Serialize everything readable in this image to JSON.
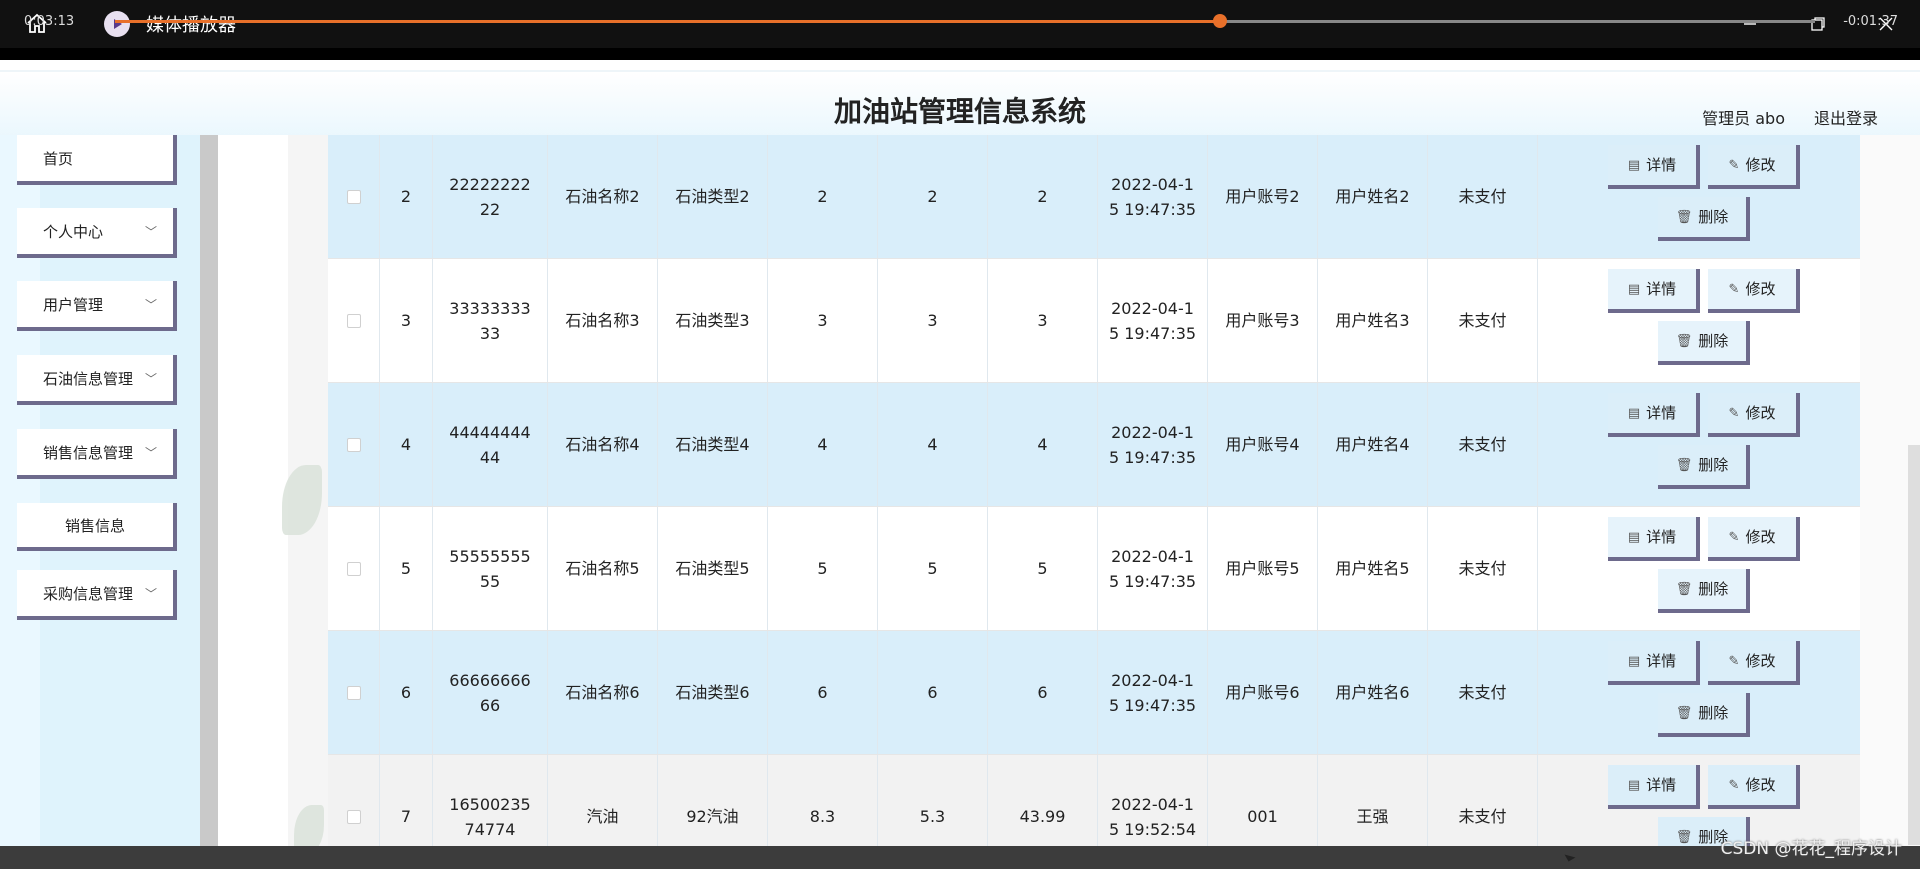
{
  "player": {
    "title": "媒体播放器",
    "time_elapsed": "0:03:13",
    "time_remaining": "-0:01:37",
    "progress_percent": 65
  },
  "header": {
    "title": "加油站管理信息系统",
    "admin_label": "管理员 abo",
    "logout_label": "退出登录"
  },
  "sidebar": {
    "items": [
      {
        "label": "首页",
        "expandable": false
      },
      {
        "label": "个人中心",
        "expandable": true
      },
      {
        "label": "用户管理",
        "expandable": true
      },
      {
        "label": "石油信息管理",
        "expandable": true
      },
      {
        "label": "销售信息管理",
        "expandable": true
      },
      {
        "label": "销售信息",
        "expandable": false,
        "submenu": true
      },
      {
        "label": "采购信息管理",
        "expandable": true
      }
    ]
  },
  "table": {
    "ops": {
      "detail": "详情",
      "edit": "修改",
      "delete": "删除"
    },
    "rows": [
      {
        "idx": "2",
        "number": "2222222222",
        "name": "石油名称2",
        "type": "石油类型2",
        "v1": "2",
        "v2": "2",
        "v3": "2",
        "time": "2022-04-15 19:47:35",
        "account": "用户账号2",
        "username": "用户姓名2",
        "status": "未支付"
      },
      {
        "idx": "3",
        "number": "3333333333",
        "name": "石油名称3",
        "type": "石油类型3",
        "v1": "3",
        "v2": "3",
        "v3": "3",
        "time": "2022-04-15 19:47:35",
        "account": "用户账号3",
        "username": "用户姓名3",
        "status": "未支付"
      },
      {
        "idx": "4",
        "number": "4444444444",
        "name": "石油名称4",
        "type": "石油类型4",
        "v1": "4",
        "v2": "4",
        "v3": "4",
        "time": "2022-04-15 19:47:35",
        "account": "用户账号4",
        "username": "用户姓名4",
        "status": "未支付"
      },
      {
        "idx": "5",
        "number": "5555555555",
        "name": "石油名称5",
        "type": "石油类型5",
        "v1": "5",
        "v2": "5",
        "v3": "5",
        "time": "2022-04-15 19:47:35",
        "account": "用户账号5",
        "username": "用户姓名5",
        "status": "未支付"
      },
      {
        "idx": "6",
        "number": "6666666666",
        "name": "石油名称6",
        "type": "石油类型6",
        "v1": "6",
        "v2": "6",
        "v3": "6",
        "time": "2022-04-15 19:47:35",
        "account": "用户账号6",
        "username": "用户姓名6",
        "status": "未支付"
      },
      {
        "idx": "7",
        "number": "1650023574774",
        "name": "汽油",
        "type": "92汽油",
        "v1": "8.3",
        "v2": "5.3",
        "v3": "43.99",
        "time": "2022-04-15 19:52:54",
        "account": "001",
        "username": "王强",
        "status": "未支付"
      }
    ]
  },
  "watermark": "CSDN @花花_程序设计",
  "colors": {
    "row_blue": "#d9eefa",
    "button_border": "#6d6a8c",
    "progress": "#e8702a",
    "sidebar_bg": "#dff3fc"
  }
}
